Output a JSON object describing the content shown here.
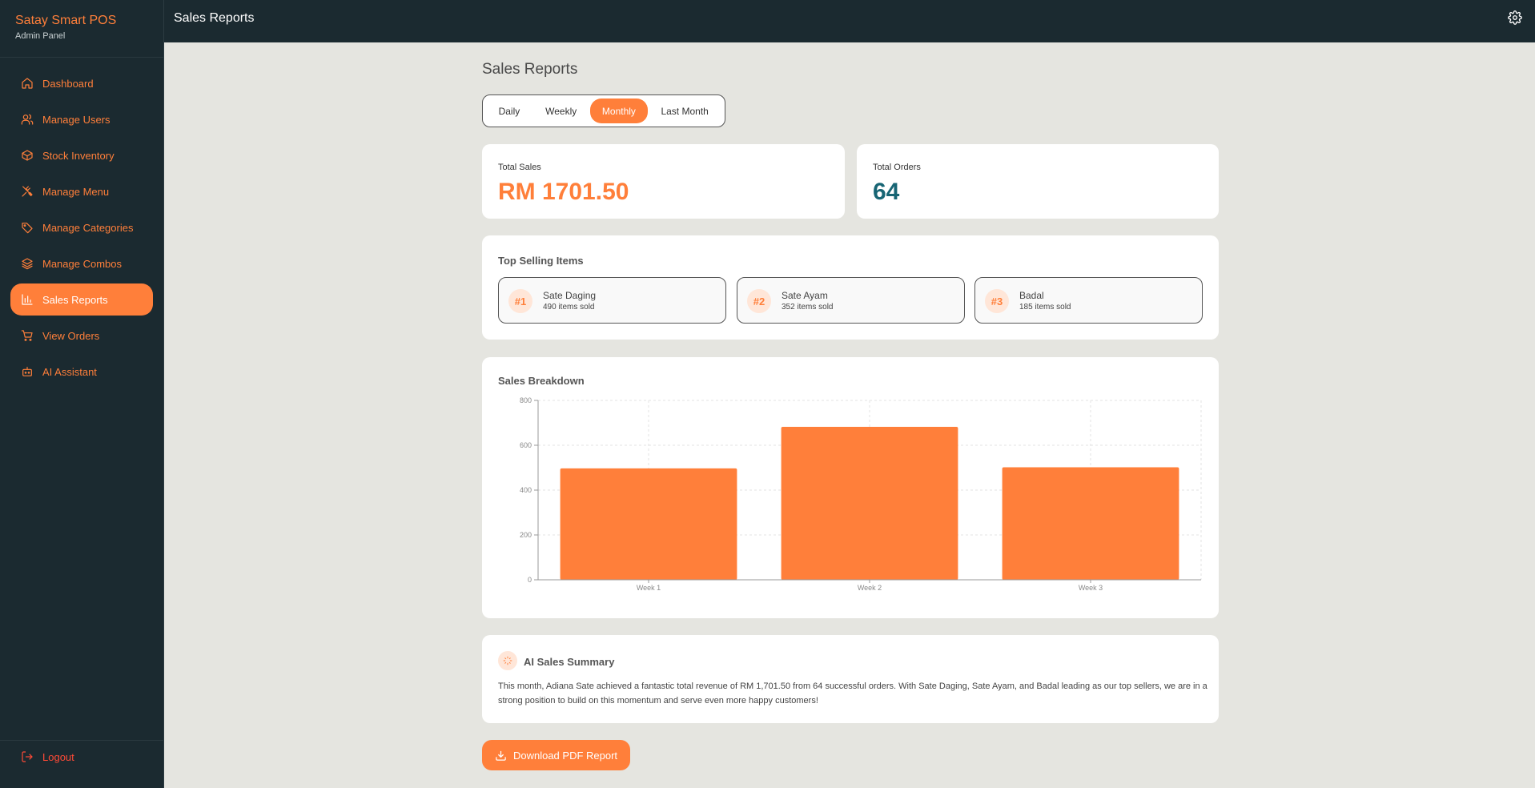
{
  "brand": {
    "title": "Satay Smart POS",
    "subtitle": "Admin Panel"
  },
  "sidebar": {
    "items": [
      {
        "label": "Dashboard",
        "icon": "home-icon"
      },
      {
        "label": "Manage Users",
        "icon": "users-icon"
      },
      {
        "label": "Stock Inventory",
        "icon": "box-icon"
      },
      {
        "label": "Manage Menu",
        "icon": "utensils-icon"
      },
      {
        "label": "Manage Categories",
        "icon": "tag-icon"
      },
      {
        "label": "Manage Combos",
        "icon": "layers-icon"
      },
      {
        "label": "Sales Reports",
        "icon": "bar-chart-icon",
        "active": true
      },
      {
        "label": "View Orders",
        "icon": "cart-icon"
      },
      {
        "label": "AI Assistant",
        "icon": "bot-icon"
      }
    ],
    "logout": "Logout"
  },
  "topbar": {
    "title": "Sales Reports"
  },
  "page": {
    "title": "Sales Reports"
  },
  "tabs": [
    "Daily",
    "Weekly",
    "Monthly",
    "Last Month"
  ],
  "active_tab": "Monthly",
  "stats": {
    "total_sales_label": "Total Sales",
    "total_sales_value": "RM 1701.50",
    "total_orders_label": "Total Orders",
    "total_orders_value": "64"
  },
  "top_selling": {
    "title": "Top Selling Items",
    "items": [
      {
        "rank": "#1",
        "name": "Sate Daging",
        "sold": "490 items sold"
      },
      {
        "rank": "#2",
        "name": "Sate Ayam",
        "sold": "352 items sold"
      },
      {
        "rank": "#3",
        "name": "Badal",
        "sold": "185 items sold"
      }
    ]
  },
  "breakdown": {
    "title": "Sales Breakdown"
  },
  "chart_data": {
    "type": "bar",
    "categories": [
      "Week 1",
      "Week 2",
      "Week 3"
    ],
    "values": [
      497,
      682,
      502
    ],
    "ylim": [
      0,
      800
    ],
    "yticks": [
      "0",
      "200",
      "400",
      "600",
      "800"
    ],
    "bar_color": "#ff7f3a",
    "grid": true,
    "title": "",
    "xlabel": "",
    "ylabel": ""
  },
  "ai_summary": {
    "title": "AI Sales Summary",
    "text": "This month, Adiana Sate achieved a fantastic total revenue of RM 1,701.50 from 64 successful orders. With Sate Daging, Sate Ayam, and Badal leading as our top sellers, we are in a strong position to build on this momentum and serve even more happy customers!"
  },
  "download_label": "Download PDF Report",
  "colors": {
    "accent": "#ff7f3a",
    "sidebar_bg": "#1b2a30",
    "orders_teal": "#176574",
    "page_bg": "#e5e5e0"
  }
}
